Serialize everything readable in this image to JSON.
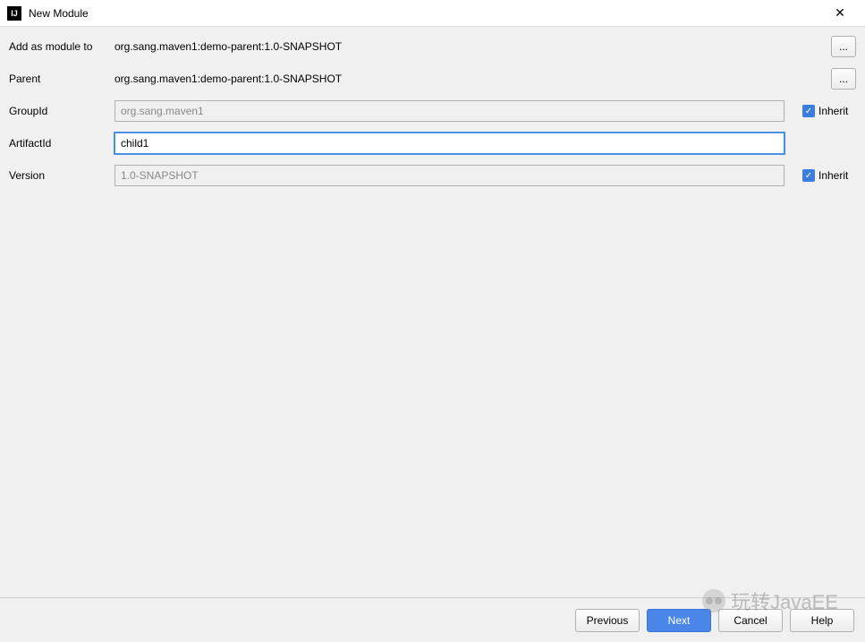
{
  "window": {
    "title": "New Module",
    "close_icon": "✕"
  },
  "form": {
    "add_module_label": "Add as module to",
    "add_module_value": "org.sang.maven1:demo-parent:1.0-SNAPSHOT",
    "parent_label": "Parent",
    "parent_value": "org.sang.maven1:demo-parent:1.0-SNAPSHOT",
    "groupid_label": "GroupId",
    "groupid_value": "org.sang.maven1",
    "artifactid_label": "ArtifactId",
    "artifactid_value": "child1",
    "version_label": "Version",
    "version_value": "1.0-SNAPSHOT",
    "inherit_label": "Inherit",
    "browse_label": "..."
  },
  "footer": {
    "previous": "Previous",
    "next": "Next",
    "cancel": "Cancel",
    "help": "Help"
  },
  "watermark": "玩转JavaEE"
}
